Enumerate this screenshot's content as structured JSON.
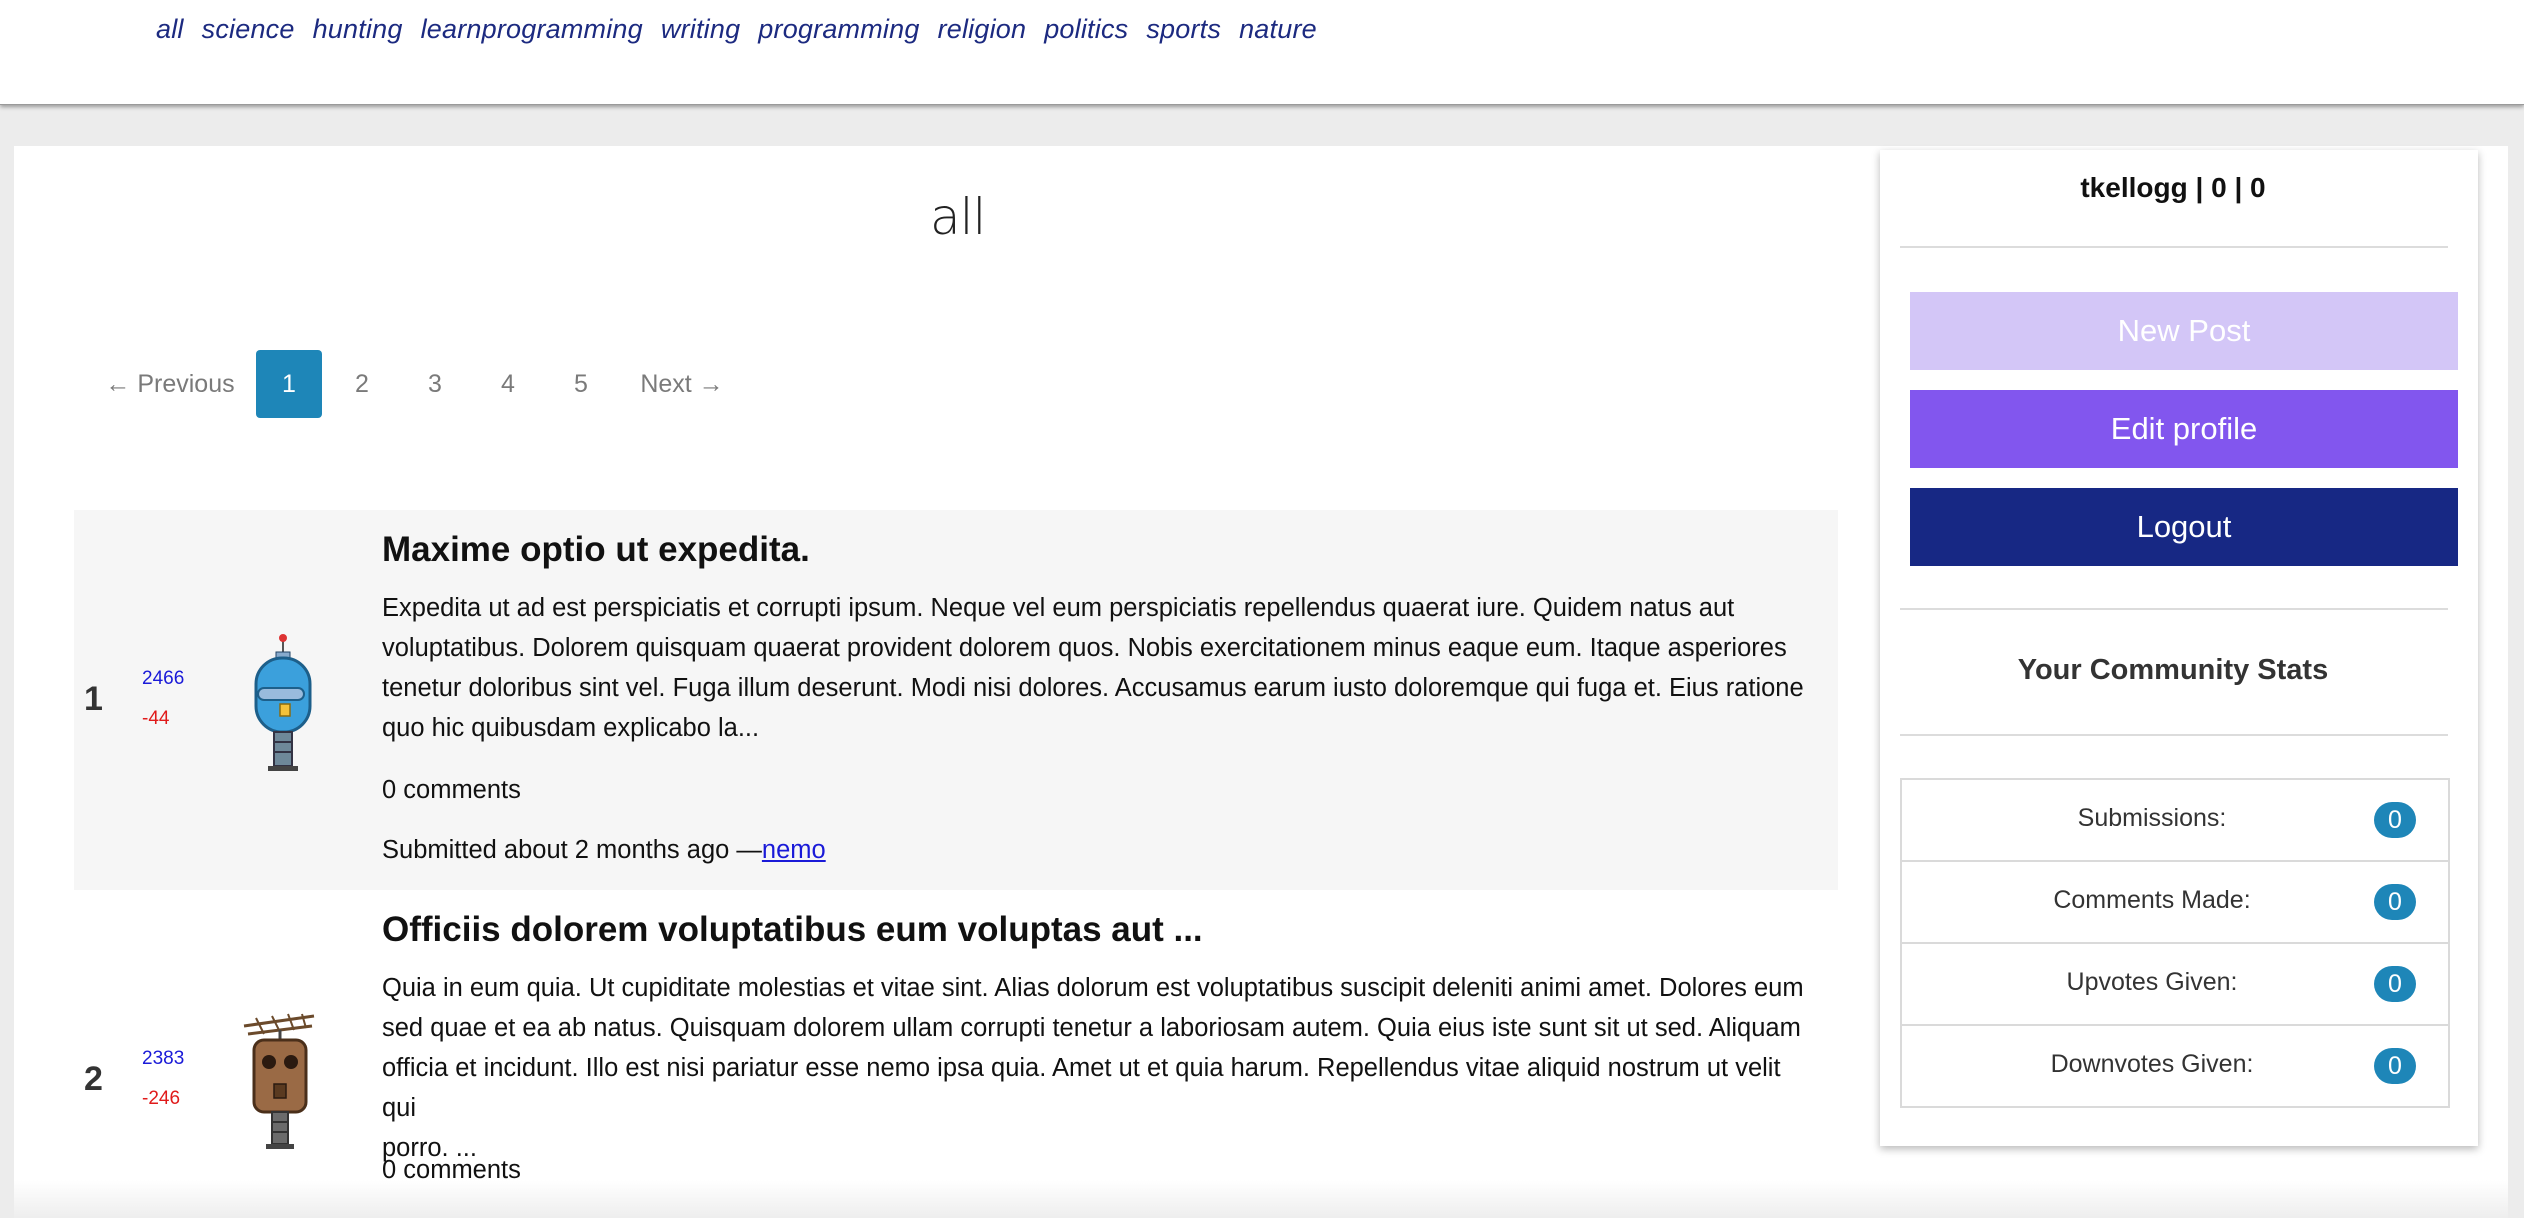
{
  "nav": {
    "items": [
      "all",
      "science",
      "hunting",
      "learnprogramming",
      "writing",
      "programming",
      "religion",
      "politics",
      "sports",
      "nature"
    ]
  },
  "page_title": "all",
  "pagination": {
    "previous": "← Previous",
    "pages": [
      "1",
      "2",
      "3",
      "4",
      "5"
    ],
    "current": "1",
    "next": "Next →"
  },
  "posts": [
    {
      "rank": "1",
      "upvotes": "2466",
      "downvotes": "-44",
      "avatar_icon": "blue-robot-icon",
      "title": "Maxime optio ut expedita.",
      "body_lines": [
        "Expedita ut ad est perspiciatis et corrupti ipsum. Neque vel eum perspiciatis repellendus quaerat iure. Quidem natus aut",
        "voluptatibus. Dolorem quisquam quaerat provident dolorem quos. Nobis exercitationem minus eaque eum. Itaque asperiores",
        "tenetur doloribus sint vel. Fuga illum deserunt. Modi nisi dolores. Accusamus earum iusto doloremque qui fuga et. Eius ratione",
        "quo hic quibusdam explicabo la..."
      ],
      "comments": "0 comments",
      "submitted": "Submitted about 2 months ago —",
      "author": "nemo"
    },
    {
      "rank": "2",
      "upvotes": "2383",
      "downvotes": "-246",
      "avatar_icon": "brown-robot-icon",
      "title": "Officiis dolorem voluptatibus eum voluptas aut ...",
      "body_lines": [
        "Quia in eum quia. Ut cupiditate molestias et vitae sint. Alias dolorum est voluptatibus suscipit deleniti animi amet. Dolores eum",
        "sed quae et ea ab natus. Quisquam dolorem ullam corrupti tenetur a laboriosam autem. Quia eius iste sunt sit ut sed. Aliquam",
        "officia et incidunt. Illo est nisi pariatur esse nemo ipsa quia. Amet ut et quia harum. Repellendus vitae aliquid nostrum ut velit qui",
        "porro. ..."
      ],
      "comments": "0 comments"
    }
  ],
  "sidebar": {
    "user_line": "tkellogg | 0 | 0",
    "new_post": "New Post",
    "edit_profile": "Edit profile",
    "logout": "Logout",
    "stats_title": "Your Community Stats",
    "stats": [
      {
        "label": "Submissions:",
        "value": "0"
      },
      {
        "label": "Comments Made:",
        "value": "0"
      },
      {
        "label": "Upvotes Given:",
        "value": "0"
      },
      {
        "label": "Downvotes Given:",
        "value": "0"
      }
    ]
  },
  "colors": {
    "accent_blue": "#1e86b8",
    "nav_link": "#1c2a80",
    "new_post_bg": "#d3c6f7",
    "edit_profile_bg": "#8256ee",
    "logout_bg": "#172884",
    "upvote": "#1a1ad8",
    "downvote": "#e01b1b"
  }
}
